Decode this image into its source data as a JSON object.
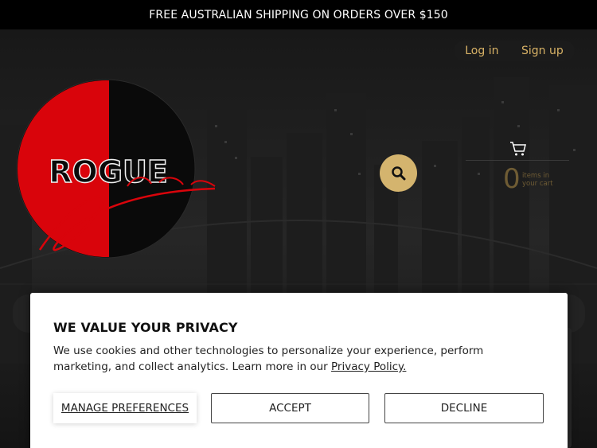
{
  "announcement": {
    "text": "FREE AUSTRALIAN SHIPPING ON ORDERS OVER $150"
  },
  "header": {
    "login_label": "Log in",
    "signup_label": "Sign up",
    "search_icon": "search-icon",
    "cart": {
      "icon": "cart-icon",
      "count": "0",
      "label": "items in your cart"
    }
  },
  "logo": {
    "text": "ROGUE",
    "script_text": "Couture",
    "colors": {
      "red": "#d9040b",
      "black": "#0a0a0a"
    }
  },
  "cookie_banner": {
    "title": "WE VALUE YOUR PRIVACY",
    "body": "We use cookies and other technologies to personalize your experience, perform marketing, and collect analytics. Learn more in our ",
    "link_label": "Privacy Policy.",
    "manage_label": "MANAGE PREFERENCES",
    "accept_label": "ACCEPT",
    "decline_label": "DECLINE"
  },
  "colors": {
    "accent": "#d4b46e",
    "link": "#d8b266",
    "background": "#141414"
  }
}
